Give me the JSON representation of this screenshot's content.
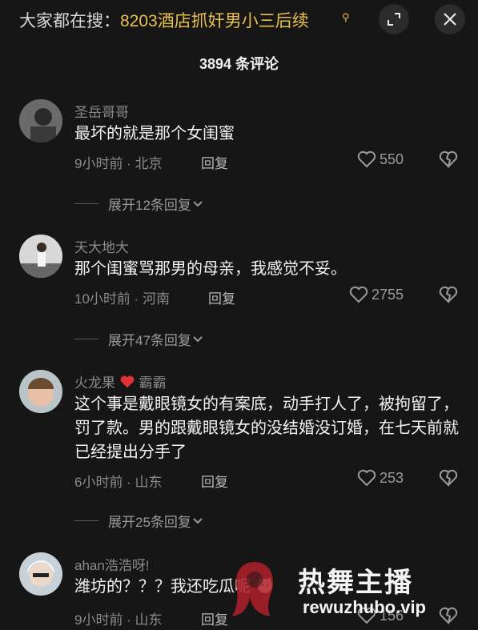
{
  "search_bar": {
    "prefix": "大家都在搜：",
    "term": "8203酒店抓奸男小三后续"
  },
  "header": {
    "title": "3894 条评论"
  },
  "comments": [
    {
      "username": "圣岳哥哥",
      "text": "最坏的就是那个女闺蜜",
      "meta": "9小时前 · 北京",
      "reply": "回复",
      "likes": "550",
      "expand": "展开12条回复"
    },
    {
      "username": "天大地大",
      "text": "那个闺蜜骂那男的母亲，我感觉不妥。",
      "meta": "10小时前 · 河南",
      "reply": "回复",
      "likes": "2755",
      "expand": "展开47条回复"
    },
    {
      "username": "火龙果",
      "username_suffix": "霸霸",
      "text": "这个事是戴眼镜女的有案底，动手打人了，被拘留了，罚了款。男的跟戴眼镜女的没结婚没订婚，在七天前就已经提出分手了",
      "meta": "6小时前 · 山东",
      "reply": "回复",
      "likes": "253",
      "expand": "展开25条回复"
    },
    {
      "username": "ahan浩浩呀!",
      "text": "潍坊的？？？我还吃瓜呢",
      "meta": "9小时前 · 山东",
      "reply": "回复",
      "likes": "156"
    }
  ],
  "watermark": {
    "title": "热舞主播",
    "url": "rewuzhubo.vip"
  },
  "icons": [
    "expand-icon",
    "close-icon",
    "heart-outline-icon",
    "broken-heart-icon",
    "chevron-down-icon",
    "red-heart-emoji-icon",
    "cat-emoji-icon",
    "search-icon"
  ]
}
